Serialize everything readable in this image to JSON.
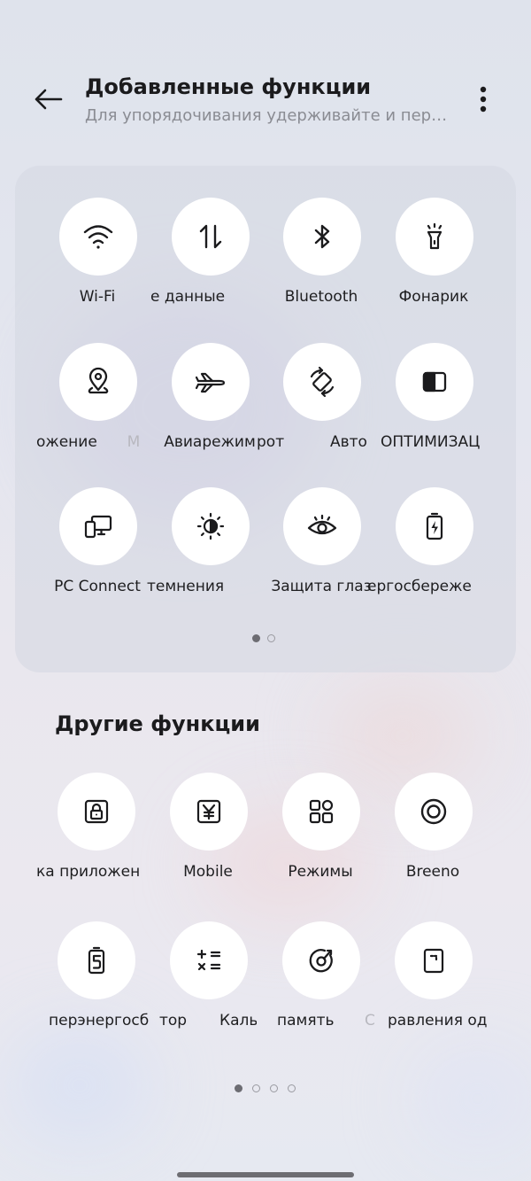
{
  "header": {
    "title": "Добавленные функции",
    "subtitle": "Для упорядочивания удерживайте и пере…"
  },
  "added": {
    "tiles": [
      {
        "label": "Wi-Fi",
        "icon": "wifi-icon"
      },
      {
        "label": "е данные",
        "icon": "mobile-data-icon"
      },
      {
        "label": "Bluetooth",
        "icon": "bluetooth-icon"
      },
      {
        "label": "Фонарик",
        "icon": "flashlight-icon"
      },
      {
        "label": "ожение",
        "icon": "location-icon"
      },
      {
        "label": "Авиарежим",
        "icon": "airplane-icon"
      },
      {
        "label": "рот",
        "icon": "auto-rotate-icon"
      },
      {
        "label": "ОПТИМИЗАЦ",
        "icon": "optimization-icon"
      },
      {
        "label": "PC Connect",
        "icon": "pc-connect-icon"
      },
      {
        "label": "темнения",
        "icon": "dimming-icon"
      },
      {
        "label": "Защита глаз",
        "icon": "eye-protection-icon"
      },
      {
        "label": "ергосбереже",
        "icon": "battery-saver-icon"
      }
    ],
    "partial_labels": [
      {
        "label": "М"
      },
      {
        "label": "Авто"
      }
    ],
    "page_count": 2,
    "active_page": 0
  },
  "other": {
    "title": "Другие функции",
    "tiles": [
      {
        "label": "ка приложен",
        "icon": "app-lock-icon"
      },
      {
        "label": "Mobile",
        "icon": "yen-icon"
      },
      {
        "label": "Режимы",
        "icon": "modes-grid-icon"
      },
      {
        "label": "Breeno",
        "icon": "breeno-icon"
      },
      {
        "label": "перэнергосбе",
        "icon": "super-power-saver-icon"
      },
      {
        "label": "Каль",
        "icon": "calculator-icon"
      },
      {
        "label": "память",
        "icon": "memory-clean-icon"
      },
      {
        "label": "равления од",
        "icon": "one-hand-mode-icon"
      }
    ],
    "partial_labels": [
      {
        "label": "тор"
      },
      {
        "label": "С"
      }
    ],
    "page_count": 4,
    "active_page": 0
  },
  "colors": {
    "panel": "#d6d8e2",
    "tile": "#ffffff",
    "text": "#1e1e20",
    "subtitle": "#8a8c93"
  }
}
